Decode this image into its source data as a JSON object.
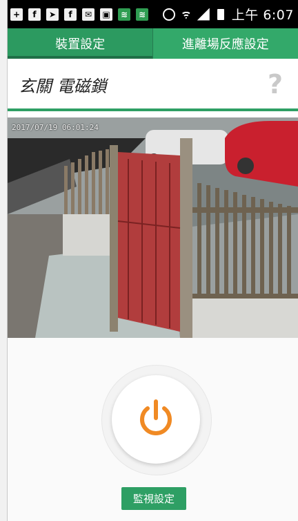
{
  "status_bar": {
    "time": "上午 6:07",
    "icons": [
      "add-box-icon",
      "facebook-icon",
      "send-icon",
      "facebook-icon",
      "mail-icon",
      "image-icon",
      "wifi-app-icon",
      "wifi-app-icon",
      "alarm-icon",
      "wifi-icon",
      "signal-icon",
      "battery-icon"
    ]
  },
  "tabs": [
    {
      "label": "裝置設定",
      "active": true
    },
    {
      "label": "進離場反應設定",
      "active": false
    }
  ],
  "header": {
    "title": "玄關 電磁鎖",
    "help_symbol": "?"
  },
  "camera": {
    "timestamp": "2017/07/19 06:01:24"
  },
  "power": {
    "icon": "power-icon",
    "color": "#f08a24"
  },
  "actions": {
    "monitor_label": "監視設定"
  },
  "colors": {
    "primary": "#2e9f64",
    "accent": "#f08a24"
  }
}
